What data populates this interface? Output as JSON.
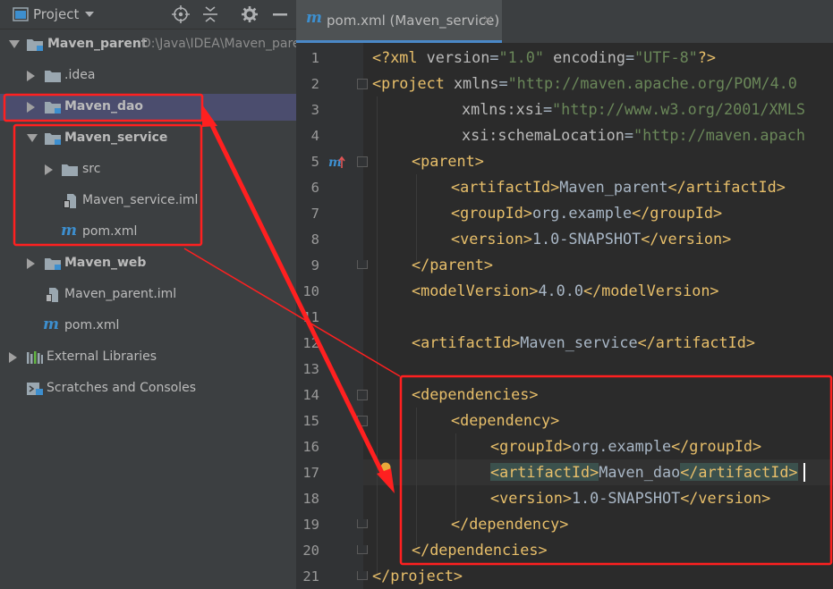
{
  "project_panel": {
    "title": "Project",
    "tree": [
      {
        "label": "Maven_parent",
        "path": "D:\\Java\\IDEA\\Maven_parent",
        "type": "module"
      },
      {
        "label": ".idea",
        "type": "folder"
      },
      {
        "label": "Maven_dao",
        "type": "module"
      },
      {
        "label": "Maven_service",
        "type": "module"
      },
      {
        "label": "src",
        "type": "folder"
      },
      {
        "label": "Maven_service.iml",
        "type": "file"
      },
      {
        "label": "pom.xml",
        "type": "maven"
      },
      {
        "label": "Maven_web",
        "type": "module"
      },
      {
        "label": "Maven_parent.iml",
        "type": "file"
      },
      {
        "label": "pom.xml",
        "type": "maven"
      },
      {
        "label": "External Libraries",
        "type": "libraries"
      },
      {
        "label": "Scratches and Consoles",
        "type": "scratches"
      }
    ]
  },
  "editor": {
    "tab_label": "pom.xml (Maven_service)",
    "tab_close": "×",
    "line_numbers": [
      "1",
      "2",
      "3",
      "4",
      "5",
      "6",
      "7",
      "8",
      "9",
      "10",
      "11",
      "12",
      "13",
      "14",
      "15",
      "16",
      "17",
      "18",
      "19",
      "20",
      "21"
    ],
    "code": {
      "l1": {
        "open": "<?xml ",
        "a1": "version",
        "eq1": "=",
        "v1": "\"1.0\"",
        "sp": " ",
        "a2": "encoding",
        "eq2": "=",
        "v2": "\"UTF-8\"",
        "close": "?>"
      },
      "l2": {
        "tag": "<project ",
        "attr": "xmlns",
        "eq": "=",
        "val": "\"http://maven.apache.org/POM/4.0"
      },
      "l3": {
        "attr": "xmlns:xsi",
        "eq": "=",
        "val": "\"http://www.w3.org/2001/XMLS"
      },
      "l4": {
        "attr": "xsi:schemaLocation",
        "eq": "=",
        "val": "\"http://maven.apach"
      },
      "l5": {
        "tag": "<parent>"
      },
      "l6": {
        "open": "<artifactId>",
        "text": "Maven_parent",
        "close": "</artifactId>"
      },
      "l7": {
        "open": "<groupId>",
        "text": "org.example",
        "close": "</groupId>"
      },
      "l8": {
        "open": "<version>",
        "text": "1.0-SNAPSHOT",
        "close": "</version>"
      },
      "l9": {
        "tag": "</parent>"
      },
      "l10": {
        "open": "<modelVersion>",
        "text": "4.0.0",
        "close": "</modelVersion>"
      },
      "l12": {
        "open": "<artifactId>",
        "text": "Maven_service",
        "close": "</artifactId>"
      },
      "l14": {
        "tag": "<dependencies>"
      },
      "l15": {
        "tag": "<dependency>"
      },
      "l16": {
        "open": "<groupId>",
        "text": "org.example",
        "close": "</groupId>"
      },
      "l17": {
        "open": "<artifactId>",
        "text": "Maven_dao",
        "close": "</artifactId>"
      },
      "l18": {
        "open": "<version>",
        "text": "1.0-SNAPSHOT",
        "close": "</version>"
      },
      "l19": {
        "tag": "</dependency>"
      },
      "l20": {
        "tag": "</dependencies>"
      },
      "l21": {
        "tag": "</project>"
      }
    }
  },
  "colors": {
    "annotation": "#ff2020",
    "selection": "#4b4d6e",
    "xml_tag": "#e8bf6a",
    "xml_value": "#6a8759",
    "maven_icon": "#3d8fcf"
  }
}
